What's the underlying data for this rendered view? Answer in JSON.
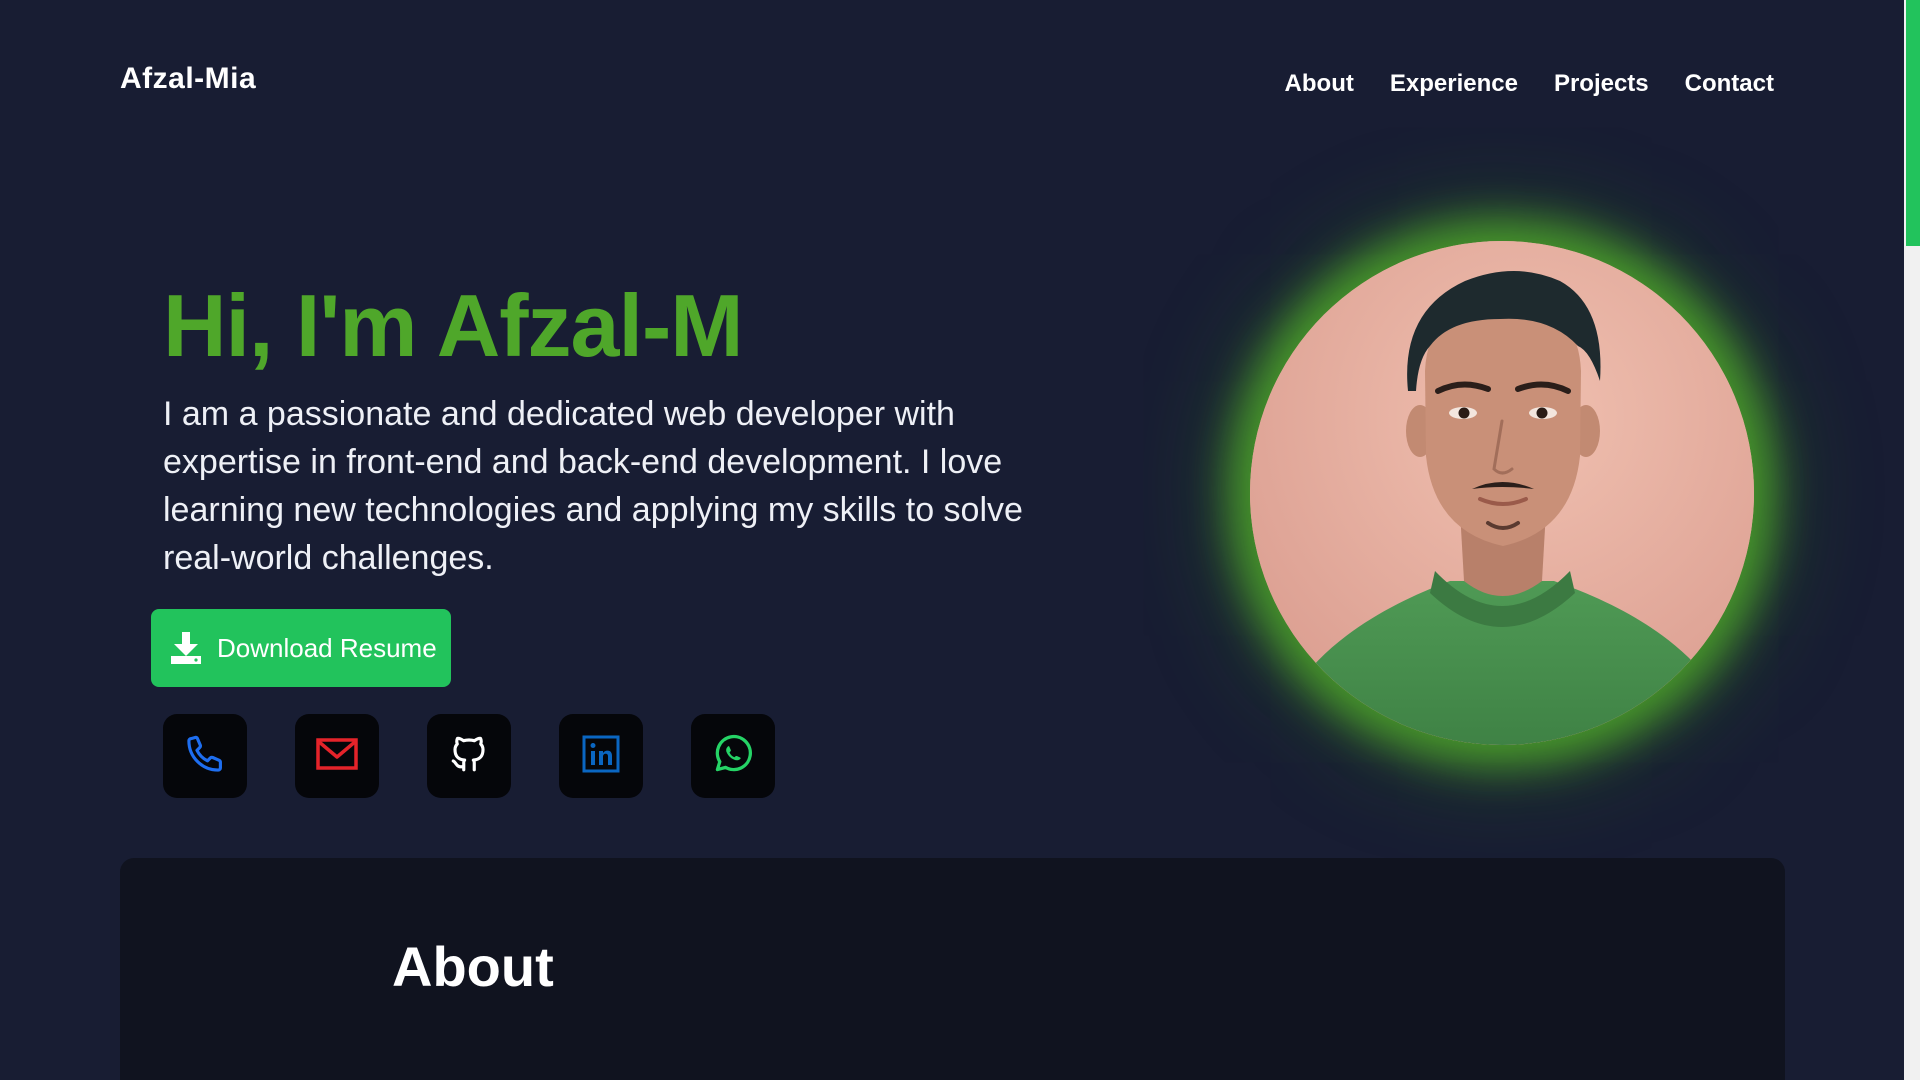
{
  "nav": {
    "brand": "Afzal-Mia",
    "links": [
      "About",
      "Experience",
      "Projects",
      "Contact"
    ]
  },
  "hero": {
    "title": "Hi, I'm Afzal-M",
    "description": "I am a passionate and dedicated web developer with expertise in front-end and back-end development. I love learning new technologies and applying my skills to solve real-world challenges.",
    "download_label": "Download Resume",
    "socials": [
      {
        "icon": "phone-icon",
        "color": "#1e6ef0"
      },
      {
        "icon": "mail-icon",
        "color": "#e5232a"
      },
      {
        "icon": "github-icon",
        "color": "#ffffff"
      },
      {
        "icon": "linkedin-icon",
        "color": "#0a66c2"
      },
      {
        "icon": "whatsapp-icon",
        "color": "#25d366"
      }
    ]
  },
  "about": {
    "title": "About"
  },
  "colors": {
    "background": "#181d33",
    "accent_green": "#22c35c",
    "title_green": "#4fa72a",
    "card_bg": "#10131f"
  }
}
